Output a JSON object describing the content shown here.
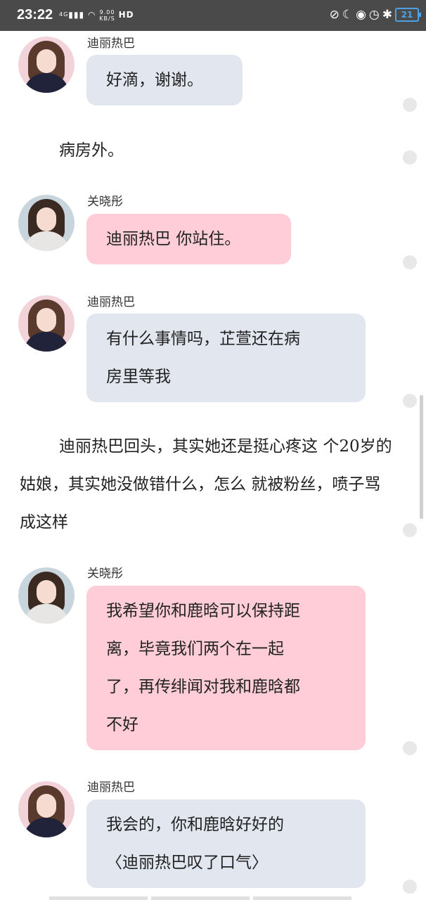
{
  "status_bar": {
    "time": "23:22",
    "network_label": "4G",
    "speed_value": "9.00",
    "speed_unit": "KB/S",
    "hd_label": "HD",
    "battery_level": "21",
    "icons": [
      "signal-icon",
      "wifi-icon",
      "mute-icon",
      "moon-icon",
      "lock-icon",
      "alarm-icon",
      "bluetooth-icon",
      "battery-icon"
    ]
  },
  "messages": [
    {
      "type": "bubble",
      "sender": "迪丽热巴",
      "bubble_color": "#e1e6ef",
      "lines": [
        "好滴，谢谢。"
      ]
    },
    {
      "type": "narration",
      "lines": [
        "病房外。"
      ]
    },
    {
      "type": "bubble",
      "sender": "关晓彤",
      "bubble_color": "#ffcdd8",
      "lines": [
        "迪丽热巴 你站住。"
      ]
    },
    {
      "type": "bubble",
      "sender": "迪丽热巴",
      "bubble_color": "#e1e6ef",
      "lines": [
        "有什么事情吗，芷萱还在病",
        "房里等我"
      ]
    },
    {
      "type": "narration",
      "lines": [
        "迪丽热巴回头，其实她还是挺心疼这",
        "个20岁的姑娘，其实她没做错什么，怎么",
        "就被粉丝，喷子骂成这样"
      ]
    },
    {
      "type": "bubble",
      "sender": "关晓彤",
      "bubble_color": "#ffcdd8",
      "lines": [
        "我希望你和鹿晗可以保持距",
        "离，毕竟我们两个在一起",
        "了，再传绯闻对我和鹿晗都",
        "不好"
      ]
    },
    {
      "type": "bubble",
      "sender": "迪丽热巴",
      "bubble_color": "#e1e6ef",
      "lines": [
        "我会的，你和鹿晗好好的",
        "〈迪丽热巴叹了口气〉"
      ]
    }
  ]
}
